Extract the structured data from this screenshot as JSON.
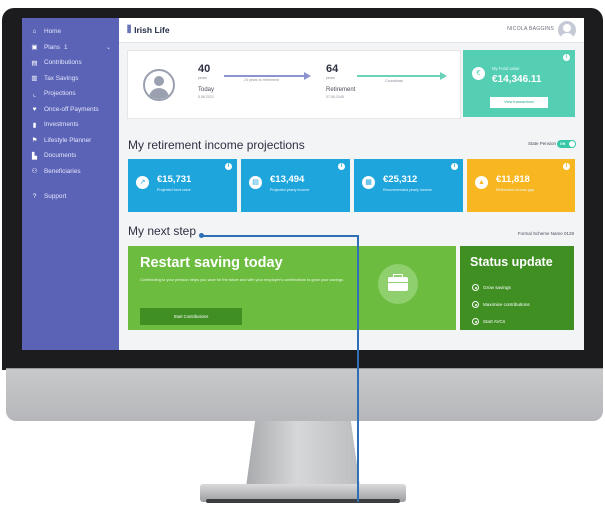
{
  "sidebar": {
    "items": [
      {
        "label": "Home",
        "icon": "home-icon",
        "glyph": "⌂"
      },
      {
        "label": "Plans",
        "icon": "folder-icon",
        "glyph": "▣",
        "badge": "1"
      },
      {
        "label": "Contributions",
        "icon": "contributions-icon",
        "glyph": "▤"
      },
      {
        "label": "Tax Savings",
        "icon": "tax-icon",
        "glyph": "▥"
      },
      {
        "label": "Projections",
        "icon": "chart-icon",
        "glyph": "⌞"
      },
      {
        "label": "Once-off Payments",
        "icon": "payment-icon",
        "glyph": "♥"
      },
      {
        "label": "Investments",
        "icon": "bar-chart-icon",
        "glyph": "▮"
      },
      {
        "label": "Lifestyle Planner",
        "icon": "planner-icon",
        "glyph": "⚑"
      },
      {
        "label": "Documents",
        "icon": "document-icon",
        "glyph": "▙"
      },
      {
        "label": "Beneficiaries",
        "icon": "people-icon",
        "glyph": "⚇"
      }
    ],
    "support": {
      "label": "Support",
      "icon": "help-icon",
      "glyph": "?"
    }
  },
  "header": {
    "logo": "Irish Life",
    "user_name": "NICOLA BAGGINS"
  },
  "summary": {
    "age_now": "40",
    "age_now_unit": "years",
    "age_now_label": "Today",
    "age_now_date": "5.06.2021",
    "years_to_retirement": "24 years to retirement",
    "age_retire": "64",
    "age_retire_unit": "years",
    "age_retire_label": "Retirement",
    "age_retire_date": "07.06.2045",
    "countdown_label": "Countdown"
  },
  "fund": {
    "label": "My Fund value",
    "value": "€14,346.11",
    "button": "View transactions"
  },
  "projections": {
    "heading": "My retirement income projections",
    "state_pension_label": "State Pension",
    "toggle": "ON",
    "tiles": [
      {
        "value": "€15,731",
        "label": "Projected fund value",
        "color": "#1ea6dc",
        "icon": "growth-icon",
        "glyph": "↗"
      },
      {
        "value": "€13,494",
        "label": "Projected yearly income",
        "color": "#1ea6dc",
        "icon": "wallet-icon",
        "glyph": "▤"
      },
      {
        "value": "€25,312",
        "label": "Recommended yearly income",
        "color": "#1ea6dc",
        "icon": "calendar-icon",
        "glyph": "▦"
      },
      {
        "value": "€11,818",
        "label": "Retirement income gap",
        "color": "#f8b621",
        "icon": "warning-icon",
        "glyph": "▲"
      }
    ]
  },
  "next_step": {
    "heading": "My next step",
    "scheme": "Formal Scheme Name 0128",
    "card_title": "Restart saving today",
    "card_desc": "Contributing to your pension helps you save for the future and with your employer's contributions to grow your savings.",
    "cta": "Start Contributions"
  },
  "status_update": {
    "title": "Status update",
    "items": [
      "Grow savings",
      "Maximise contributions",
      "Start AVCs"
    ]
  }
}
